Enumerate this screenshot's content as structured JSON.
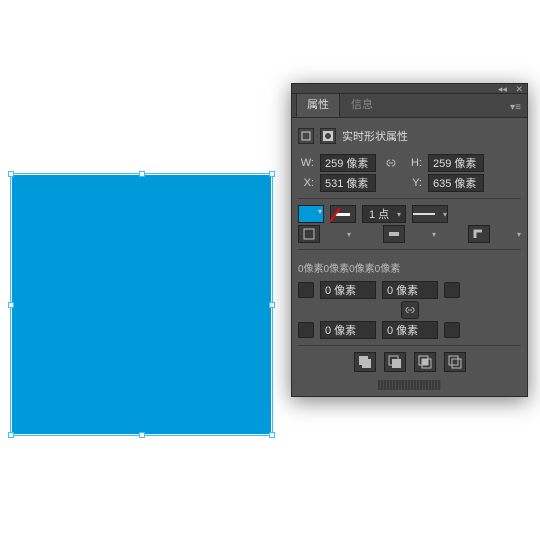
{
  "shape": {
    "fill": "#0099d9"
  },
  "tabs": {
    "t0": "属性",
    "t1": "信息"
  },
  "section": {
    "title": "实时形状属性"
  },
  "dims": {
    "w_label": "W:",
    "w": "259 像素",
    "h_label": "H:",
    "h": "259 像素",
    "x_label": "X:",
    "x": "531 像素",
    "y_label": "Y:",
    "y": "635 像素"
  },
  "stroke": {
    "weight": "1 点"
  },
  "corners": {
    "summary": "0像素0像素0像素0像素",
    "tl": "0 像素",
    "tr": "0 像素",
    "bl": "0 像素",
    "br": "0 像素"
  },
  "icons": {
    "link": "⬳",
    "close": "✕",
    "menu": "▸▸"
  }
}
